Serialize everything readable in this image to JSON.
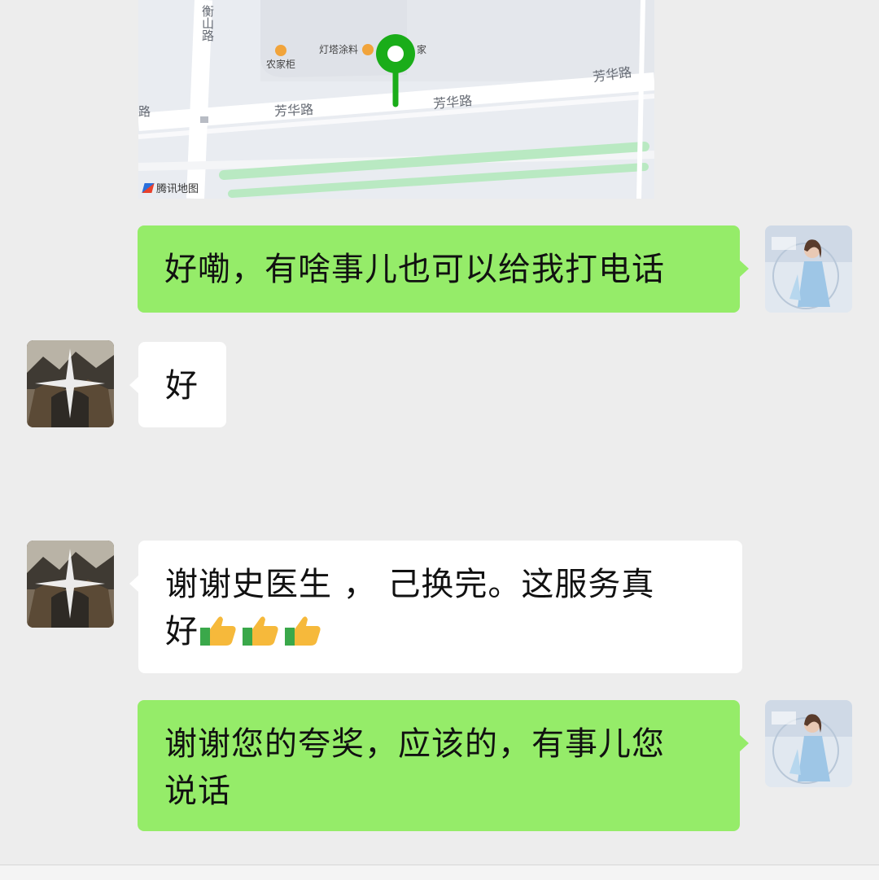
{
  "map": {
    "road_labels": [
      "衡山路",
      "芳华路",
      "芳华路",
      "芳华路",
      "路"
    ],
    "poi_labels": [
      "农家柜",
      "灯塔涂料",
      "家"
    ],
    "watermark": "腾讯地图",
    "pin_color": "#1aad19"
  },
  "messages": [
    {
      "sender": "self",
      "text": "好嘞，有啥事儿也可以给我打电话"
    },
    {
      "sender": "other",
      "text": "好"
    },
    {
      "sender": "other",
      "text": "谢谢史医生 ， 己换完。这服务真",
      "text_line2": "好",
      "emoji": "thumbs-up-icon ×3"
    },
    {
      "sender": "self",
      "text": "谢谢您的夸奖，应该的，有事儿您",
      "text_line2": "说话"
    }
  ],
  "colors": {
    "self_bubble": "#95ec69",
    "other_bubble": "#ffffff",
    "background": "#ededed"
  }
}
